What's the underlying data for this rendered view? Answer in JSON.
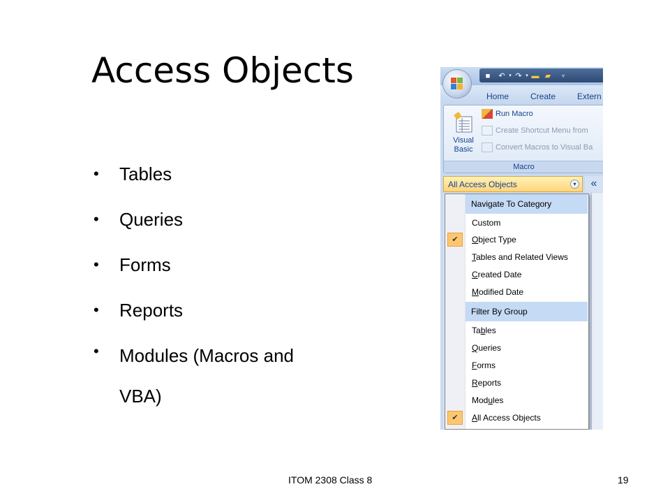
{
  "slide": {
    "title": "Access Objects",
    "bullets": [
      "Tables",
      "Queries",
      "Forms",
      "Reports",
      "Modules (Macros and VBA)"
    ],
    "footer": "ITOM 2308 Class 8",
    "page_number": "19"
  },
  "access": {
    "tabs": [
      "Home",
      "Create",
      "Extern"
    ],
    "ribbon": {
      "visual_basic_label": "Visual Basic",
      "items": [
        "Run Macro",
        "Create Shortcut Menu from",
        "Convert Macros to Visual Ba"
      ],
      "group_label": "Macro"
    },
    "nav_pane": {
      "header": "All Access Objects",
      "shutter_glyph": "«",
      "menu": {
        "category_heading": "Navigate To Category",
        "categories": [
          {
            "pre": "",
            "key": "",
            "post": "Custom",
            "checked": false
          },
          {
            "pre": "",
            "key": "O",
            "post": "bject Type",
            "checked": true
          },
          {
            "pre": "",
            "key": "T",
            "post": "ables and Related Views",
            "checked": false
          },
          {
            "pre": "",
            "key": "C",
            "post": "reated Date",
            "checked": false
          },
          {
            "pre": "",
            "key": "M",
            "post": "odified Date",
            "checked": false
          }
        ],
        "group_heading": "Filter By Group",
        "groups": [
          {
            "pre": "Ta",
            "key": "b",
            "post": "les",
            "checked": false
          },
          {
            "pre": "",
            "key": "Q",
            "post": "ueries",
            "checked": false
          },
          {
            "pre": "",
            "key": "F",
            "post": "orms",
            "checked": false
          },
          {
            "pre": "",
            "key": "R",
            "post": "eports",
            "checked": false
          },
          {
            "pre": "Mod",
            "key": "u",
            "post": "les",
            "checked": false
          },
          {
            "pre": "",
            "key": "A",
            "post": "ll Access Objects",
            "checked": true
          }
        ]
      }
    },
    "colors": {
      "highlight_header": "#c5daf5",
      "check_bg": "#fdc770",
      "nav_header": "#ffd47c",
      "ribbon_text": "#15428b"
    }
  }
}
